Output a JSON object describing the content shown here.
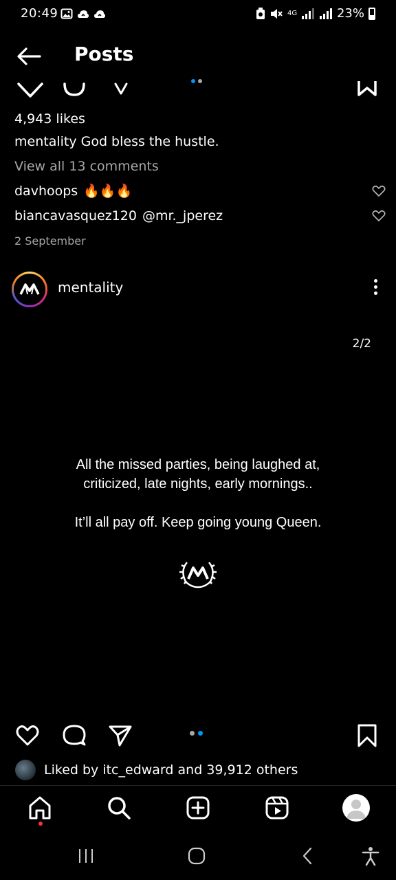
{
  "status_bar": {
    "time": "20:49",
    "left_icons": [
      "gallery-icon",
      "cloud-icon",
      "cloud-icon"
    ],
    "right_icons": [
      "alarm-icon",
      "mute-icon",
      "network-4g-icon",
      "signal-icon",
      "signal-icon"
    ],
    "network_label": "4G",
    "battery": "23%"
  },
  "header": {
    "title": "Posts",
    "back_icon": "arrow-left-icon"
  },
  "previous_post": {
    "likes": "4,943 likes",
    "caption_user": "mentality",
    "caption_text": "God bless the hustle.",
    "view_comments": "View all 13 comments",
    "comments": [
      {
        "user": "davhoops",
        "text": "🔥🔥🔥"
      },
      {
        "user": "biancavasquez120",
        "text": "@mr._jperez"
      }
    ],
    "date": "2 September"
  },
  "post": {
    "username": "mentality",
    "page_counter": "2/2",
    "quote_line1": "All the missed parties, being laughed at,",
    "quote_line2": "criticized, late nights, early mornings..",
    "quote_line3": "It’ll all pay off. Keep going young Queen.",
    "carousel_index": 2,
    "carousel_total": 2,
    "liked_by_prefix": "Liked by ",
    "liked_by_user": "itc_edward",
    "liked_by_and": " and ",
    "liked_by_others": "39,912 others"
  },
  "bottom_nav": [
    "home-icon",
    "search-icon",
    "create-icon",
    "reels-icon",
    "profile-icon"
  ],
  "system_nav": [
    "recents-icon",
    "home-icon",
    "back-icon",
    "accessibility-icon"
  ],
  "colors": {
    "background": "#000000",
    "text": "#ffffff",
    "secondary_text": "#a8a8a8",
    "accent_blue": "#0095f6",
    "notification_red": "#ff3040"
  }
}
